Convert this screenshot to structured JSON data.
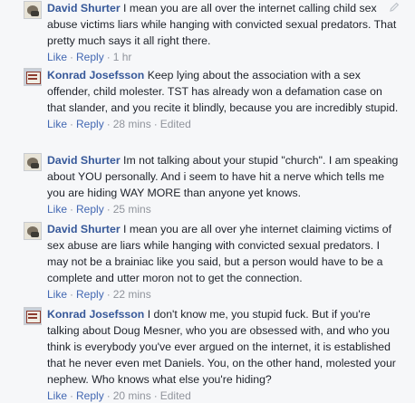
{
  "thread": {
    "comments": [
      {
        "author": "David Shurter",
        "text": " I mean you are all over the internet calling child sex abuse victims liars while hanging with convicted sexual predators. That pretty much says it all right there.",
        "like": "Like",
        "reply": "Reply",
        "time": "1 hr",
        "edited": ""
      },
      {
        "author": "Konrad Josefsson",
        "text": " Keep lying about the association with a sex offender, child molester. TST has already won a defamation case on that slander, and you recite it blindly, because you are incredibly stupid.",
        "like": "Like",
        "reply": "Reply",
        "time": "28 mins",
        "edited": "Edited"
      },
      {
        "author": "David Shurter",
        "text": " Im not talking about your stupid \"church\". I am speaking about YOU personally. And i seem to have hit a nerve which tells me you are hiding WAY MORE than anyone yet knows.",
        "like": "Like",
        "reply": "Reply",
        "time": "25 mins",
        "edited": ""
      },
      {
        "author": "David Shurter",
        "text": " I mean you are all over yhe internet claiming victims of sex abuse are liars while hanging with convicted sexual predators. I may not be a brainiac like you said, but a person would have to be a complete and utter moron not to get the connection.",
        "like": "Like",
        "reply": "Reply",
        "time": "22 mins",
        "edited": ""
      },
      {
        "author": "Konrad Josefsson",
        "text": " I don't know me, you stupid fuck. But if you're talking about Doug Mesner, who you are obsessed with, and who you think is everybody you've ever argued on the internet, it is established that he never even met Daniels. You, on the other hand, molested your nephew. Who knows what else you're hiding?",
        "like": "Like",
        "reply": "Reply",
        "time": "20 mins",
        "edited": "Edited"
      }
    ]
  }
}
